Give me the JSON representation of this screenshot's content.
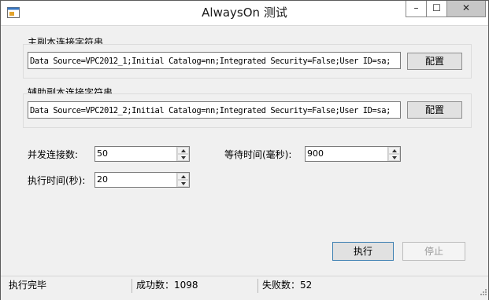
{
  "window": {
    "title": "AlwaysOn 测试",
    "controls": {
      "minimize": "–",
      "maximize": "☐",
      "close": "✕"
    }
  },
  "primary": {
    "label": "主副本连接字符串",
    "connection_string": "Data Source=VPC2012_1;Initial Catalog=nn;Integrated Security=False;User ID=sa;",
    "configure_label": "配置"
  },
  "secondary": {
    "label": "辅助副本连接字符串",
    "connection_string": "Data Source=VPC2012_2;Initial Catalog=nn;Integrated Security=False;User ID=sa;",
    "configure_label": "配置"
  },
  "settings": {
    "concurrency": {
      "label": "并发连接数:",
      "value": "50"
    },
    "exec_time": {
      "label": "执行时间(秒):",
      "value": "20"
    },
    "wait_time": {
      "label": "等待时间(毫秒):",
      "value": "900"
    }
  },
  "actions": {
    "execute": "执行",
    "stop": "停止"
  },
  "status": {
    "state": "执行完毕",
    "success": "成功数：1098",
    "failure": "失败数：52"
  }
}
